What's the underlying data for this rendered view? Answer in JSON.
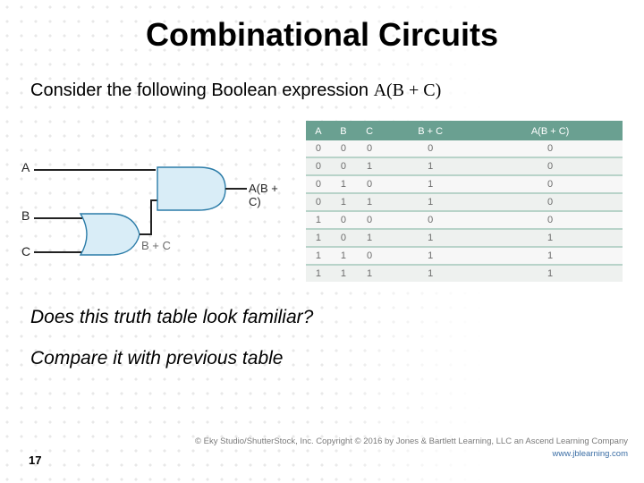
{
  "title": "Combinational Circuits",
  "intro_prefix": "Consider the following Boolean expression ",
  "intro_expr": "A(B + C)",
  "circuit": {
    "inA": "A",
    "inB": "B",
    "inC": "C",
    "or_out": "B + C",
    "and_out": "A(B + C)"
  },
  "table": {
    "headers": [
      "A",
      "B",
      "C",
      "B + C",
      "A(B + C)"
    ],
    "rows": [
      [
        "0",
        "0",
        "0",
        "0",
        "0"
      ],
      [
        "0",
        "0",
        "1",
        "1",
        "0"
      ],
      [
        "0",
        "1",
        "0",
        "1",
        "0"
      ],
      [
        "0",
        "1",
        "1",
        "1",
        "0"
      ],
      [
        "1",
        "0",
        "0",
        "0",
        "0"
      ],
      [
        "1",
        "0",
        "1",
        "1",
        "1"
      ],
      [
        "1",
        "1",
        "0",
        "1",
        "1"
      ],
      [
        "1",
        "1",
        "1",
        "1",
        "1"
      ]
    ]
  },
  "question1": "Does this truth table look familiar?",
  "question2": "Compare it with previous table",
  "page_number": "17",
  "copyright_line1": "© Eky Studio/ShutterStock, Inc. Copyright © 2016 by Jones & Bartlett Learning, LLC an Ascend Learning Company",
  "copyright_url": "www.jblearning.com",
  "chart_data": {
    "type": "table",
    "title": "Truth table for A(B + C)",
    "columns": [
      "A",
      "B",
      "C",
      "B + C",
      "A(B + C)"
    ],
    "rows": [
      [
        0,
        0,
        0,
        0,
        0
      ],
      [
        0,
        0,
        1,
        1,
        0
      ],
      [
        0,
        1,
        0,
        1,
        0
      ],
      [
        0,
        1,
        1,
        1,
        0
      ],
      [
        1,
        0,
        0,
        0,
        0
      ],
      [
        1,
        0,
        1,
        1,
        1
      ],
      [
        1,
        1,
        0,
        1,
        1
      ],
      [
        1,
        1,
        1,
        1,
        1
      ]
    ]
  }
}
